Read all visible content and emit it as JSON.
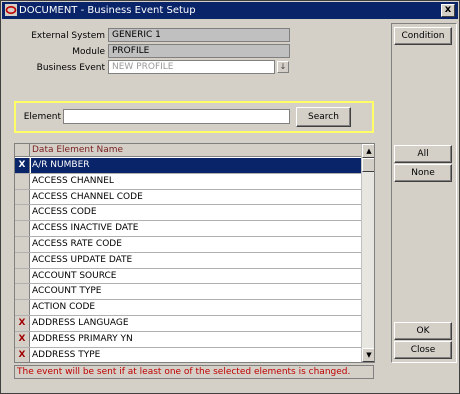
{
  "window": {
    "title": "DOCUMENT - Business Event Setup",
    "close_label": "x",
    "app_icon": "oracle-app-icon",
    "close_icon": "close-icon"
  },
  "form": {
    "external_system": {
      "label": "External System",
      "value": "GENERIC 1"
    },
    "module": {
      "label": "Module",
      "value": "PROFILE"
    },
    "business_event": {
      "label": "Business Event",
      "value": "NEW PROFILE"
    }
  },
  "search": {
    "label": "Element",
    "value": "",
    "button_label": "Search"
  },
  "grid": {
    "column_header": "Data Element Name",
    "rows": [
      {
        "selected_mark": "X",
        "name": "A/R NUMBER",
        "active": true
      },
      {
        "selected_mark": "",
        "name": "ACCESS CHANNEL"
      },
      {
        "selected_mark": "",
        "name": "ACCESS CHANNEL CODE"
      },
      {
        "selected_mark": "",
        "name": "ACCESS CODE"
      },
      {
        "selected_mark": "",
        "name": "ACCESS INACTIVE DATE"
      },
      {
        "selected_mark": "",
        "name": "ACCESS RATE CODE"
      },
      {
        "selected_mark": "",
        "name": "ACCESS UPDATE DATE"
      },
      {
        "selected_mark": "",
        "name": "ACCOUNT SOURCE"
      },
      {
        "selected_mark": "",
        "name": "ACCOUNT TYPE"
      },
      {
        "selected_mark": "",
        "name": "ACTION CODE"
      },
      {
        "selected_mark": "X",
        "name": "ADDRESS LANGUAGE"
      },
      {
        "selected_mark": "X",
        "name": "ADDRESS PRIMARY YN"
      },
      {
        "selected_mark": "X",
        "name": "ADDRESS TYPE"
      }
    ]
  },
  "side_buttons": {
    "condition": "Condition",
    "all": "All",
    "none": "None",
    "ok": "OK",
    "close": "Close"
  },
  "status_message": "The event will be sent if at least one of the selected elements is changed.",
  "colors": {
    "title_bar": "#0a246a",
    "window_bg": "#d4d0c8",
    "highlight_box": "#ffff66",
    "status_text": "#c00000",
    "selected_mark": "#a00000"
  }
}
